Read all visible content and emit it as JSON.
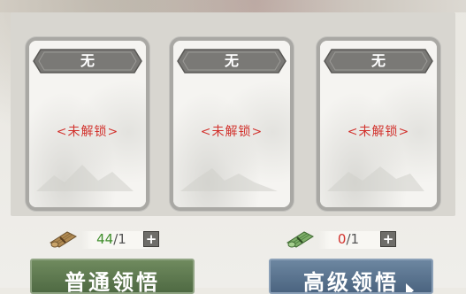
{
  "cards": [
    {
      "title": "无",
      "status": "<未解锁>"
    },
    {
      "title": "无",
      "status": "<未解锁>"
    },
    {
      "title": "无",
      "status": "<未解锁>"
    }
  ],
  "resources": [
    {
      "icon": "scroll-bundle-icon",
      "current": "44",
      "separator": "/",
      "total": "1",
      "current_color": "#3f8e2c"
    },
    {
      "icon": "green-scroll-icon",
      "current": "0",
      "separator": "/",
      "total": "1",
      "current_color": "#d2322d"
    }
  ],
  "buttons": {
    "normal_label": "普通领悟",
    "advanced_label": "高级领悟"
  }
}
